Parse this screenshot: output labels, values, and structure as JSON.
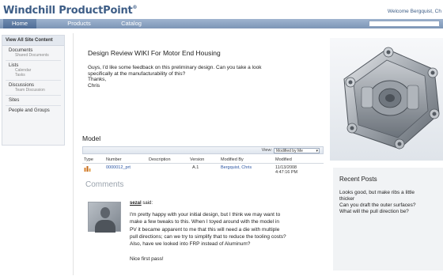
{
  "header": {
    "brand": "Windchill ProductPoint",
    "welcome": "Welcome Bergquist, Ch"
  },
  "nav": {
    "tabs": [
      "Home",
      "Products",
      "Catalog"
    ]
  },
  "sidebar": {
    "heading": "View All Site Content",
    "groups": [
      {
        "label": "Documents",
        "subs": [
          "Shared Documents"
        ]
      },
      {
        "label": "Lists",
        "subs": [
          "Calendar",
          "Tasks"
        ]
      },
      {
        "label": "Discussions",
        "subs": [
          "Team Discussion"
        ]
      },
      {
        "label": "Sites",
        "subs": []
      },
      {
        "label": "People and Groups",
        "subs": []
      }
    ]
  },
  "document": {
    "title": "Design Review WIKI For Motor End Housing",
    "body_lines": [
      "Guys, I'd like some feedback on this preliminary design.  Can you take a look",
      "specifically at the manufacturability of this?",
      "Thanks,",
      "Chris"
    ]
  },
  "model": {
    "label": "Model",
    "view_label": "View:",
    "view_value": "Modified by Me",
    "columns": [
      "Type",
      "Number",
      "Description",
      "Version",
      "Modified By",
      "Modified"
    ],
    "row": {
      "number": "0000012_prt",
      "description": "",
      "version": "A.1",
      "modified_by": "Bergquist, Chris",
      "modified_date": "11/13/2008",
      "modified_time": "4:47:16 PM"
    }
  },
  "comments": {
    "title": "Comments",
    "author": "sezal",
    "said": "said:",
    "text_lines": [
      "I'm pretty happy with your initial design, but I think we may want to",
      "make a few tweaks to this.  When I toyed around with the model in",
      "PV it became apparent to me that this will need a die with multiple",
      "pull directions; can we try to simplify that to reduce the tooling costs?",
      "Also, have we looked into FRP instead of Aluminum?"
    ],
    "extra": "Nice first pass!"
  },
  "recent_posts": {
    "title": "Recent Posts",
    "lines": [
      "Looks good, but make ribs a little",
      "thicker",
      "Can you draft the outer surfaces?",
      "What will the pull direction be?"
    ]
  }
}
